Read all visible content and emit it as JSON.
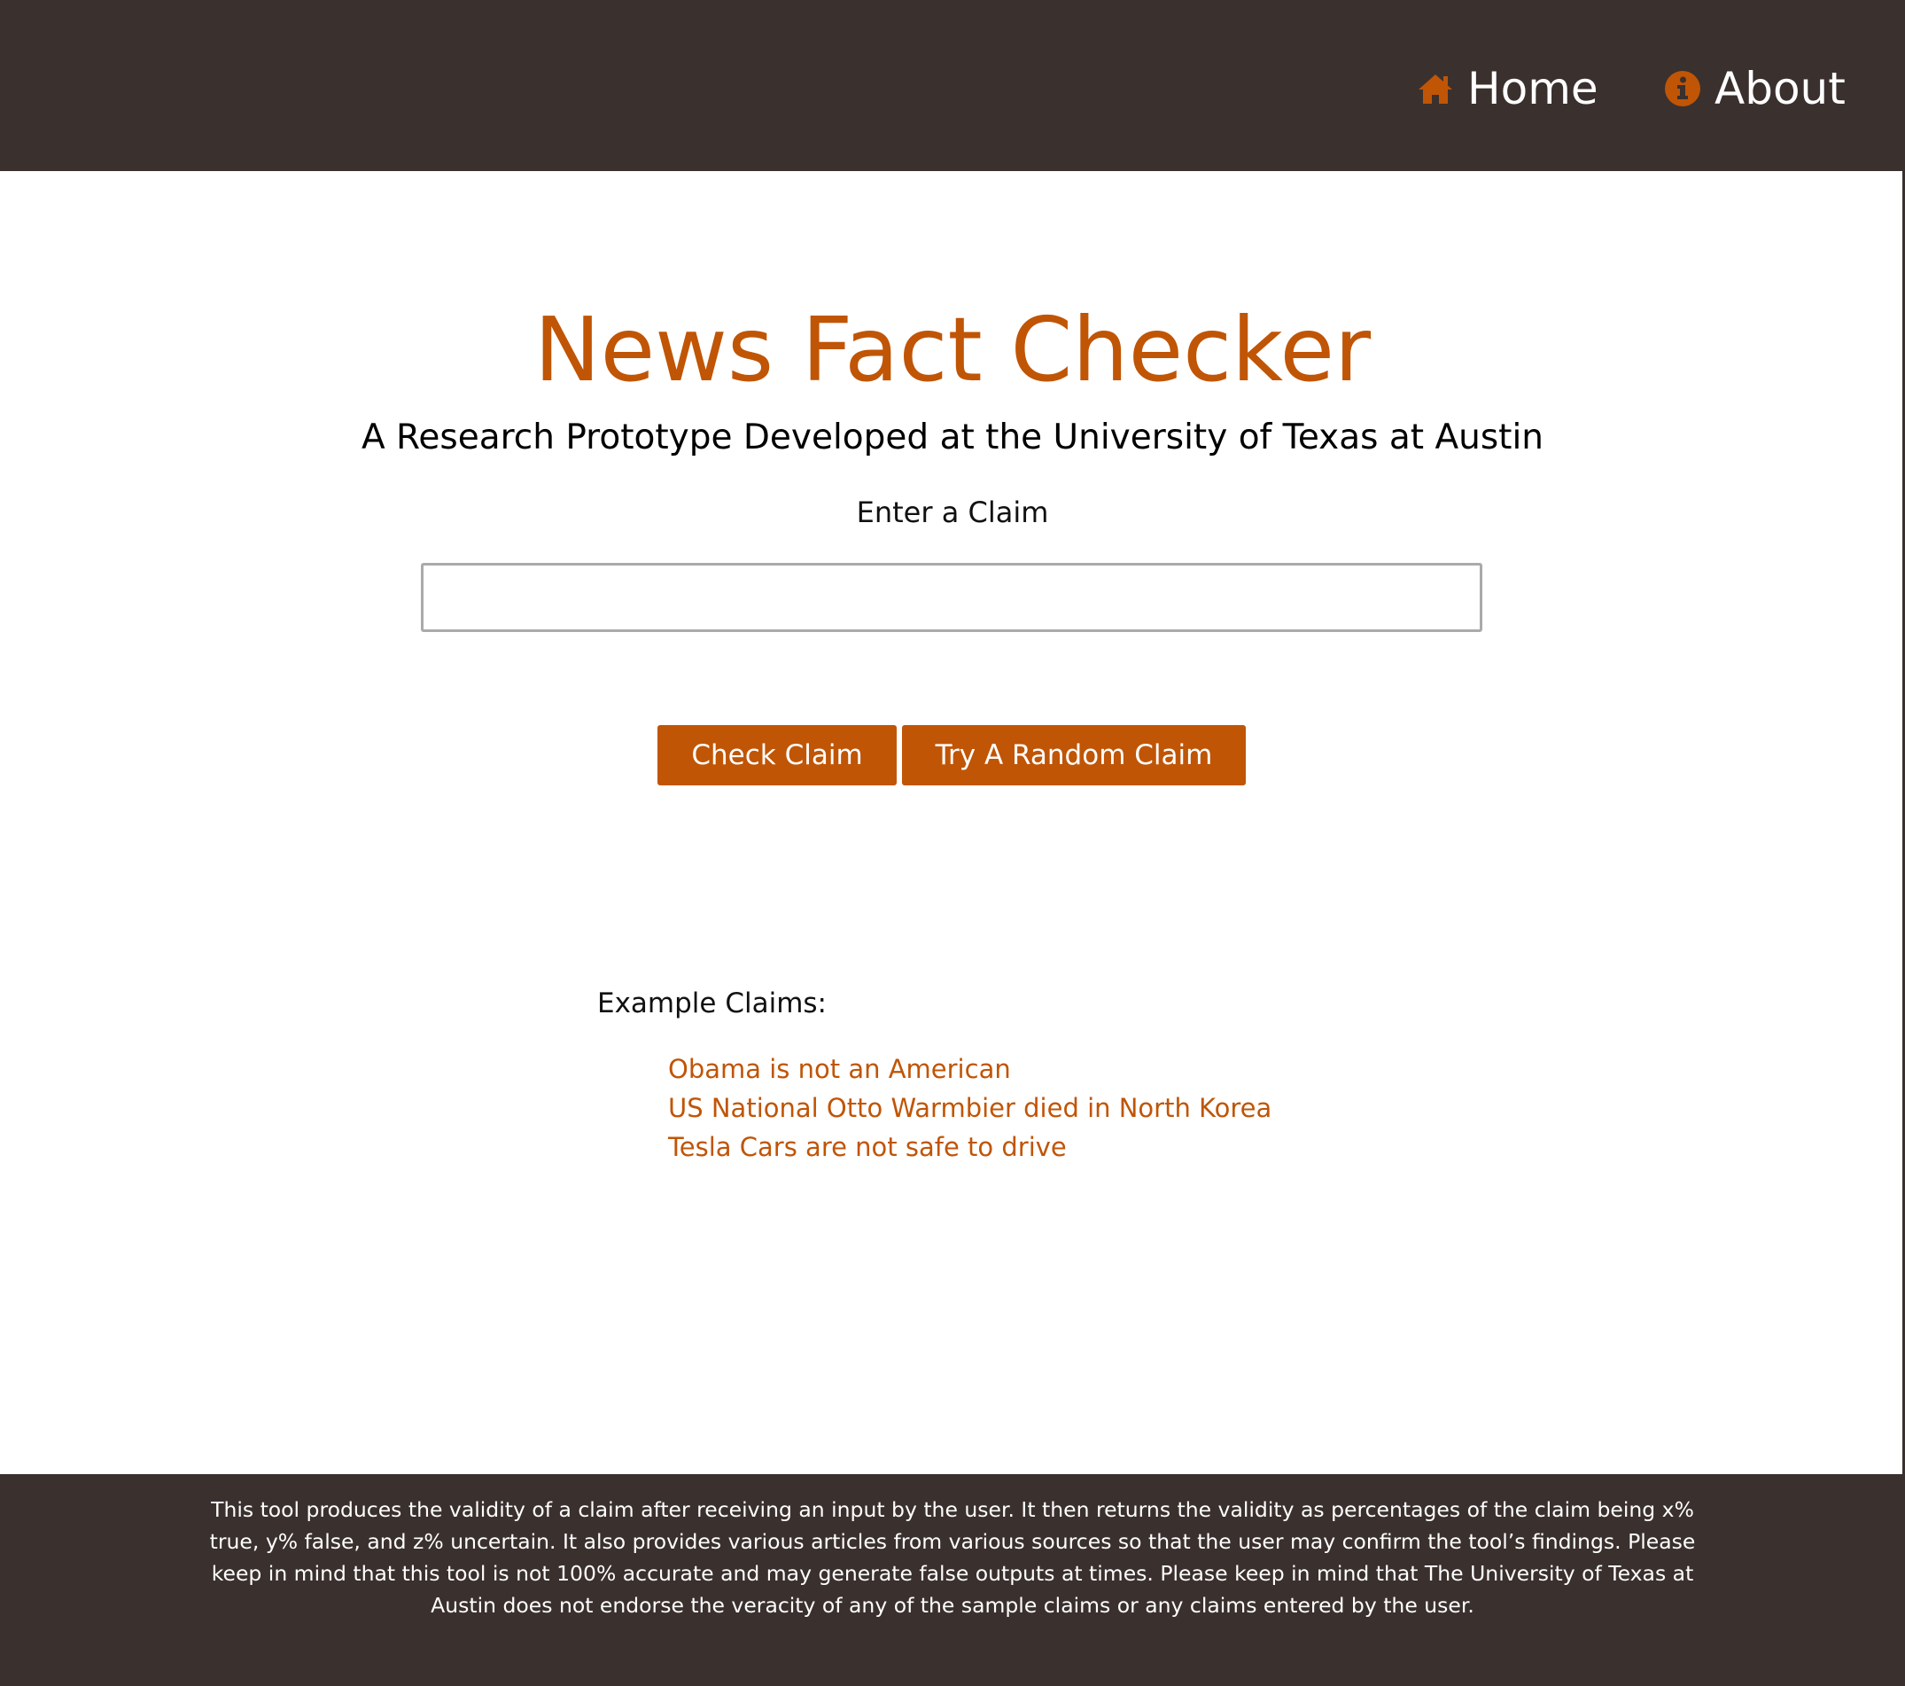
{
  "colors": {
    "header_bg": "#3a302e",
    "accent": "#c05506",
    "footer_bg": "#3a302e"
  },
  "nav": {
    "home": {
      "icon": "home-icon",
      "label": "Home"
    },
    "about": {
      "icon": "info-icon",
      "label": "About"
    }
  },
  "main": {
    "title": "News Fact Checker",
    "subtitle": "A Research Prototype Developed at the University of Texas at Austin",
    "input_label": "Enter a Claim",
    "input_value": "",
    "check_button": "Check Claim",
    "random_button": "Try A Random Claim",
    "examples_heading": "Example Claims:",
    "examples": [
      "Obama is not an American",
      "US National Otto Warmbier died in North Korea",
      "Tesla Cars are not safe to drive"
    ]
  },
  "footer": {
    "text": "This tool produces the validity of a claim after receiving an input by the user. It then returns the validity as percentages of the claim being x% true, y% false, and z% uncertain. It also provides various articles from various sources so that the user may confirm the tool’s findings. Please keep in mind that this tool is not 100% accurate and may generate false outputs at times. Please keep in mind that The University of Texas at Austin does not endorse the veracity of any of the sample claims or any claims entered by the user."
  }
}
